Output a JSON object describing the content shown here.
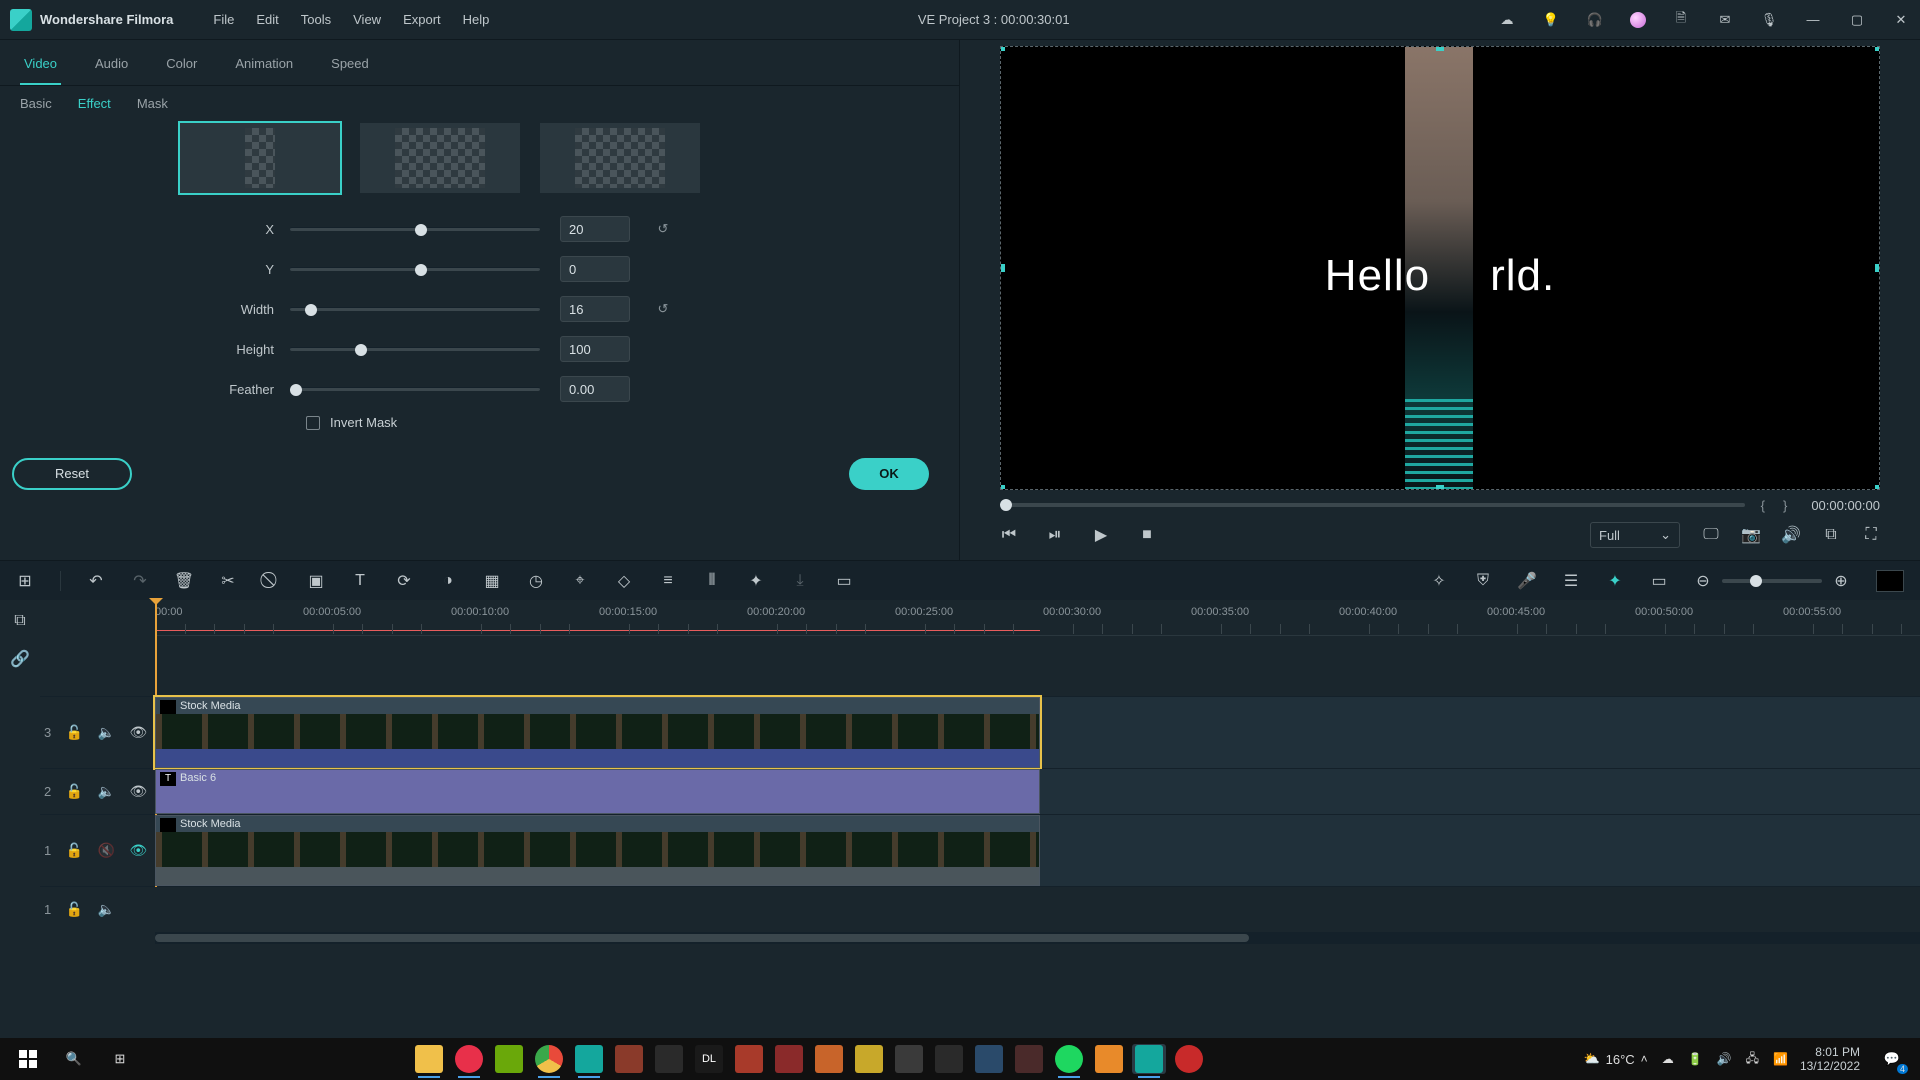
{
  "app": {
    "name": "Wondershare Filmora"
  },
  "menu": {
    "file": "File",
    "edit": "Edit",
    "tools": "Tools",
    "view": "View",
    "export": "Export",
    "help": "Help"
  },
  "project": {
    "title": "VE Project 3 : 00:00:30:01"
  },
  "props_tabs1": {
    "video": "Video",
    "audio": "Audio",
    "color": "Color",
    "animation": "Animation",
    "speed": "Speed"
  },
  "props_tabs2": {
    "basic": "Basic",
    "effect": "Effect",
    "mask": "Mask"
  },
  "mask": {
    "x_label": "X",
    "x_value": "20",
    "y_label": "Y",
    "y_value": "0",
    "width_label": "Width",
    "width_value": "16",
    "height_label": "Height",
    "height_value": "100",
    "feather_label": "Feather",
    "feather_value": "0.00",
    "invert_label": "Invert Mask"
  },
  "buttons": {
    "reset": "Reset",
    "ok": "OK"
  },
  "preview": {
    "text_left": "Hello",
    "text_right": "rld.",
    "timecode": "00:00:00:00",
    "quality": "Full"
  },
  "ruler": {
    "labels": [
      "00:00",
      "00:00:05:00",
      "00:00:10:00",
      "00:00:15:00",
      "00:00:20:00",
      "00:00:25:00",
      "00:00:30:00",
      "00:00:35:00",
      "00:00:40:00",
      "00:00:45:00",
      "00:00:50:00",
      "00:00:55:00"
    ]
  },
  "tracks": {
    "t3_num": "3",
    "t2_num": "2",
    "t1_num": "1",
    "a1_num": "1",
    "clip1_label": "Stock Media",
    "clip2_label": "Basic 6",
    "clip3_label": "Stock Media",
    "clip2_badge": "T"
  },
  "taskbar": {
    "temp": "16°C",
    "time": "8:01 PM",
    "date": "13/12/2022",
    "notif_count": "4"
  }
}
